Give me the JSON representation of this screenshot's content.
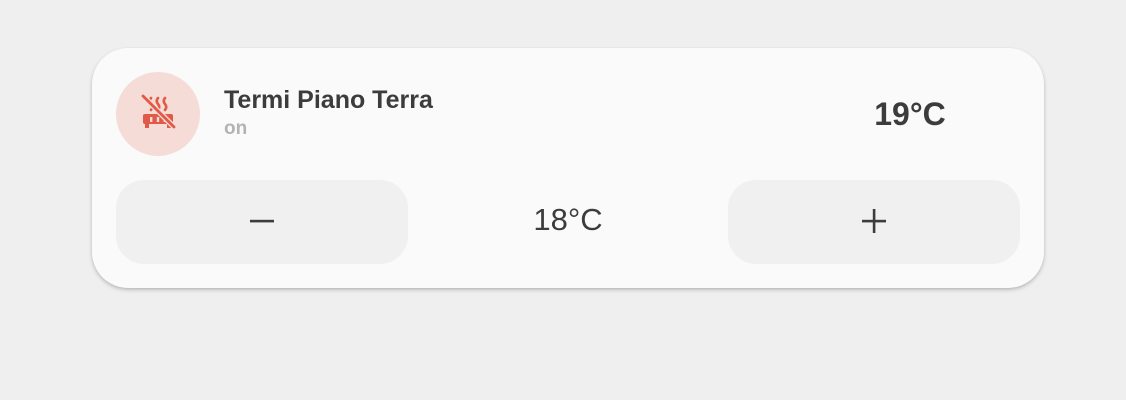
{
  "entity": {
    "name": "Termi Piano Terra",
    "state": "on",
    "current_temperature": "19°C",
    "target_temperature": "18°C",
    "icon": "radiator-off-icon"
  },
  "controls": {
    "decrease_icon": "minus-icon",
    "increase_icon": "plus-icon"
  },
  "colors": {
    "background": "#efefef",
    "card": "#fafafa",
    "icon_accent": "#e05a47",
    "icon_background": "#f6dcd7",
    "button_background": "#f0f0f0",
    "primary_text": "#3c3c3c",
    "secondary_text": "#b3b3b3"
  }
}
